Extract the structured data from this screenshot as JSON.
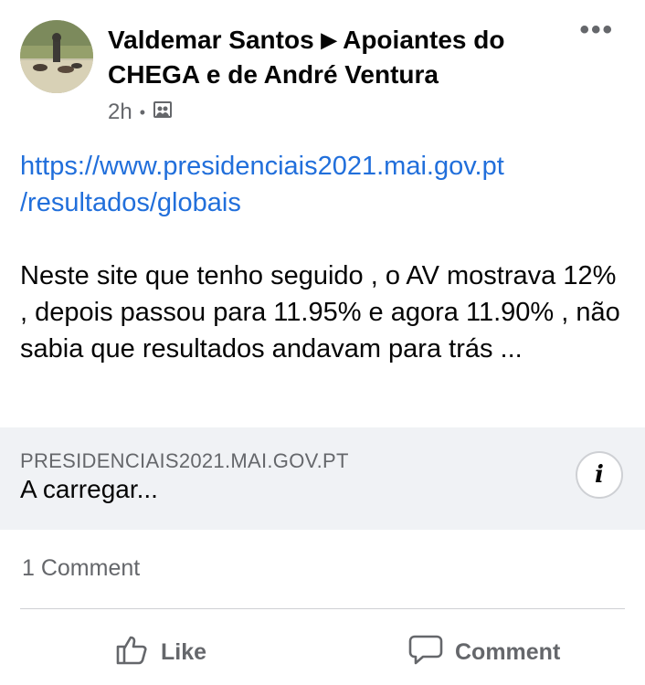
{
  "post": {
    "author": "Valdemar Santos",
    "separator": "▶",
    "group": "Apoiantes do CHEGA e de André Ventura",
    "time": "2h",
    "time_separator": "•",
    "more_label": "•••",
    "link_line1": "https://www.presidenciais2021.mai.gov.pt",
    "link_line2": "/resultados/globais",
    "text": "Neste site que tenho seguido , o AV mostrava 12% , depois passou para 11.95% e agora 11.90% , não sabia que resultados andavam para trás ..."
  },
  "preview": {
    "domain": "PRESIDENCIAIS2021.MAI.GOV.PT",
    "status": "A carregar...",
    "info_label": "i"
  },
  "stats": {
    "comments": "1 Comment"
  },
  "actions": {
    "like": "Like",
    "comment": "Comment"
  },
  "icons": {
    "audience": "group-audience-icon",
    "like": "thumbs-up-icon",
    "comment": "speech-bubble-icon"
  },
  "colors": {
    "link": "#216fdb",
    "secondary_text": "#65676b",
    "preview_bg": "#f0f2f5"
  }
}
